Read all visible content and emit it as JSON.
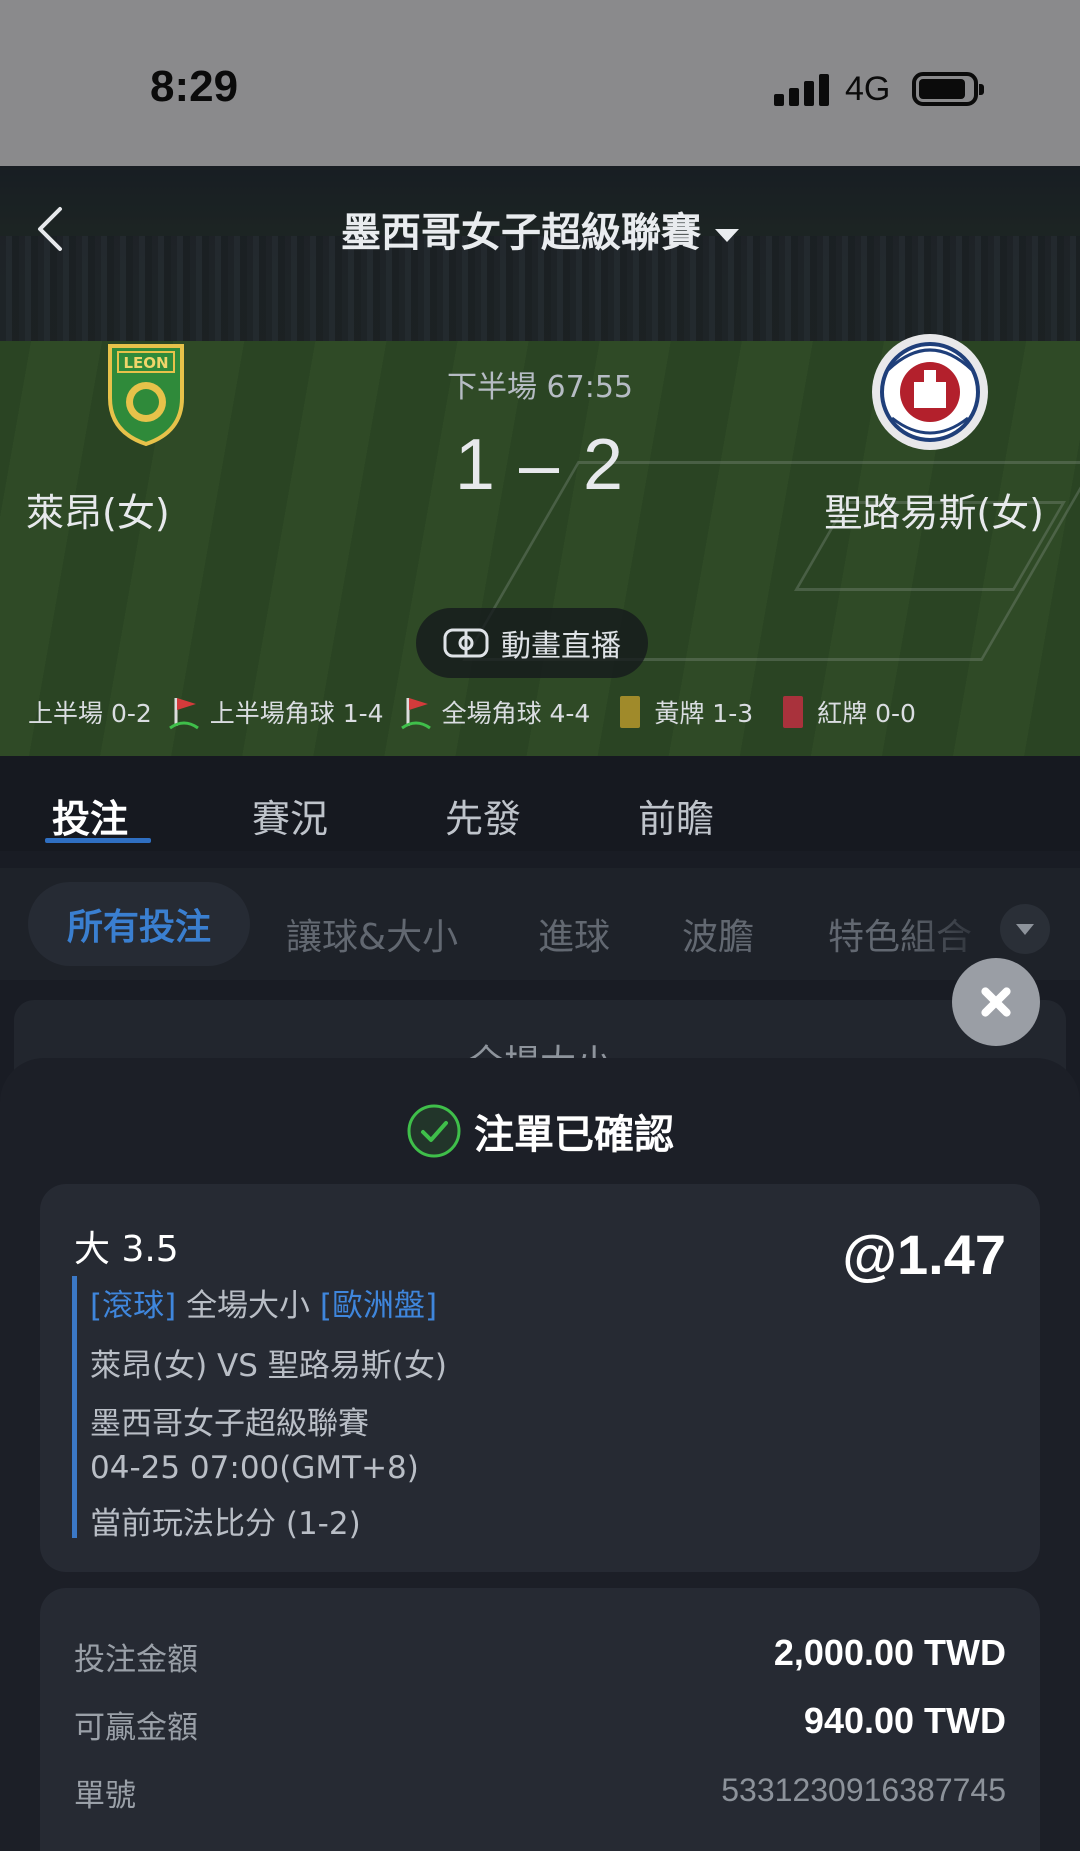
{
  "status_bar": {
    "time": "8:29",
    "network": "4G"
  },
  "header": {
    "league": "墨西哥女子超級聯賽"
  },
  "match": {
    "home": "萊昂(女)",
    "away": "聖路易斯(女)",
    "period": "下半場 67:55",
    "score": "1 – 2",
    "live_label": "動畫直播",
    "stats": {
      "first_half": "上半場 0-2",
      "first_half_corners": "上半場角球 1-4",
      "full_corners": "全場角球 4-4",
      "yellow": "黃牌 1-3",
      "red": "紅牌 0-0"
    }
  },
  "tabs": [
    "投注",
    "賽況",
    "先發",
    "前瞻"
  ],
  "filters": [
    "所有投注",
    "讓球&大小",
    "進球",
    "波膽",
    "特色組合"
  ],
  "behind_title": "全場大小",
  "sheet": {
    "title": "注單已確認",
    "selection": "大 3.5",
    "odds": "@1.47",
    "tag_live": "[滾球]",
    "market": "全場大小",
    "tag_odds": "[歐洲盤]",
    "teams": "萊昂(女) VS 聖路易斯(女)",
    "league": "墨西哥女子超級聯賽",
    "datetime": "04-25 07:00(GMT+8)",
    "current_score": "當前玩法比分 (1-2)",
    "stake_label": "投注金額",
    "stake_value": "2,000.00 TWD",
    "win_label": "可贏金額",
    "win_value": "940.00 TWD",
    "id_label": "單號",
    "id_value": "5331230916387745"
  },
  "colors": {
    "accent": "#3a7fd0",
    "success": "#3fbf4a",
    "yellow_card": "#a08a2a",
    "red_card": "#a9323c"
  }
}
